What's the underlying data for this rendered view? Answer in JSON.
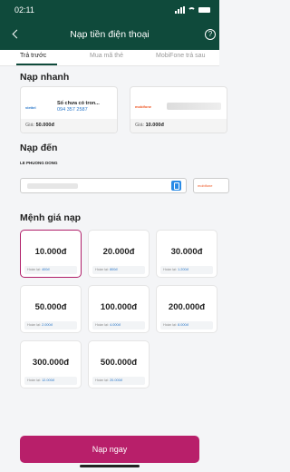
{
  "status": {
    "time": "02:11"
  },
  "header": {
    "title": "Nạp tiền điện thoại",
    "help_icon": "?"
  },
  "tabs": [
    {
      "label": "Trả trước",
      "active": true
    },
    {
      "label": "Mua mã thẻ",
      "active": false
    },
    {
      "label": "MobiFone trả sau",
      "active": false
    }
  ],
  "quick": {
    "title": "Nạp nhanh",
    "cards": [
      {
        "logo": "viettel",
        "name": "Số chưa có tron...",
        "number": "094 357 2587",
        "price_label": "Giá:",
        "price": "50.000đ"
      },
      {
        "logo": "mobifone",
        "name": "",
        "number": "",
        "price_label": "Giá:",
        "price": "10.000đ"
      }
    ]
  },
  "recipient": {
    "title": "Nạp đến",
    "name": "LE PHUONG DONG",
    "carrier": "mobifone"
  },
  "denominations": {
    "title": "Mệnh giá nạp",
    "cashback_label": "Hoàn lại:",
    "items": [
      {
        "value": "10.000đ",
        "cashback": "400đ",
        "selected": true
      },
      {
        "value": "20.000đ",
        "cashback": "800đ",
        "selected": false
      },
      {
        "value": "30.000đ",
        "cashback": "1.200đ",
        "selected": false
      },
      {
        "value": "50.000đ",
        "cashback": "2.000đ",
        "selected": false
      },
      {
        "value": "100.000đ",
        "cashback": "4.000đ",
        "selected": false
      },
      {
        "value": "200.000đ",
        "cashback": "8.000đ",
        "selected": false
      },
      {
        "value": "300.000đ",
        "cashback": "12.000đ",
        "selected": false
      },
      {
        "value": "500.000đ",
        "cashback": "20.000đ",
        "selected": false
      }
    ]
  },
  "action": {
    "pay_label": "Nạp ngay"
  },
  "colors": {
    "header": "#0f4a3b",
    "accent": "#b81f6a",
    "link": "#2a77c9"
  }
}
